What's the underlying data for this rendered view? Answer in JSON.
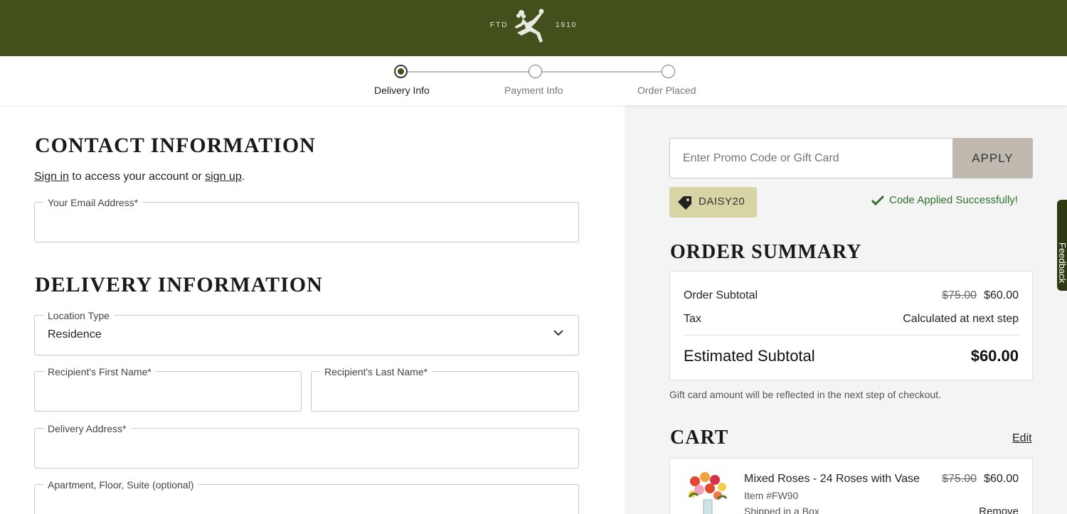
{
  "header": {
    "logo_left": "FTD",
    "logo_right": "1910",
    "brand_color": "#43501b"
  },
  "steps": [
    {
      "label": "Delivery Info",
      "active": true
    },
    {
      "label": "Payment Info",
      "active": false
    },
    {
      "label": "Order Placed",
      "active": false
    }
  ],
  "contact": {
    "title": "CONTACT INFORMATION",
    "sign_in_link": "Sign in",
    "sign_in_middle": " to access your account or ",
    "sign_up_link": "sign up",
    "sign_in_end": ".",
    "email_label": "Your Email Address*",
    "email_value": ""
  },
  "delivery": {
    "title": "DELIVERY INFORMATION",
    "location_type_label": "Location Type",
    "location_type_value": "Residence",
    "first_name_label": "Recipient's First Name*",
    "last_name_label": "Recipient's Last Name*",
    "address_label": "Delivery Address*",
    "apartment_label": "Apartment, Floor, Suite (optional)"
  },
  "promo": {
    "placeholder": "Enter Promo Code or Gift Card",
    "apply_label": "APPLY",
    "applied_code": "DAISY20",
    "success_message": "Code Applied Successfully!"
  },
  "summary": {
    "title": "ORDER SUMMARY",
    "subtotal_label": "Order Subtotal",
    "subtotal_original": "$75.00",
    "subtotal_value": "$60.00",
    "tax_label": "Tax",
    "tax_value": "Calculated at next step",
    "estimated_label": "Estimated Subtotal",
    "estimated_value": "$60.00",
    "gift_note": "Gift card amount will be reflected in the next step of checkout."
  },
  "cart": {
    "title": "CART",
    "edit_label": "Edit",
    "items": [
      {
        "name": "Mixed Roses - 24 Roses with Vase",
        "original_price": "$75.00",
        "price": "$60.00",
        "sku": "Item #FW90",
        "shipping": "Shipped in a Box",
        "remove_label": "Remove"
      }
    ]
  },
  "feedback": {
    "label": "Feedback"
  }
}
